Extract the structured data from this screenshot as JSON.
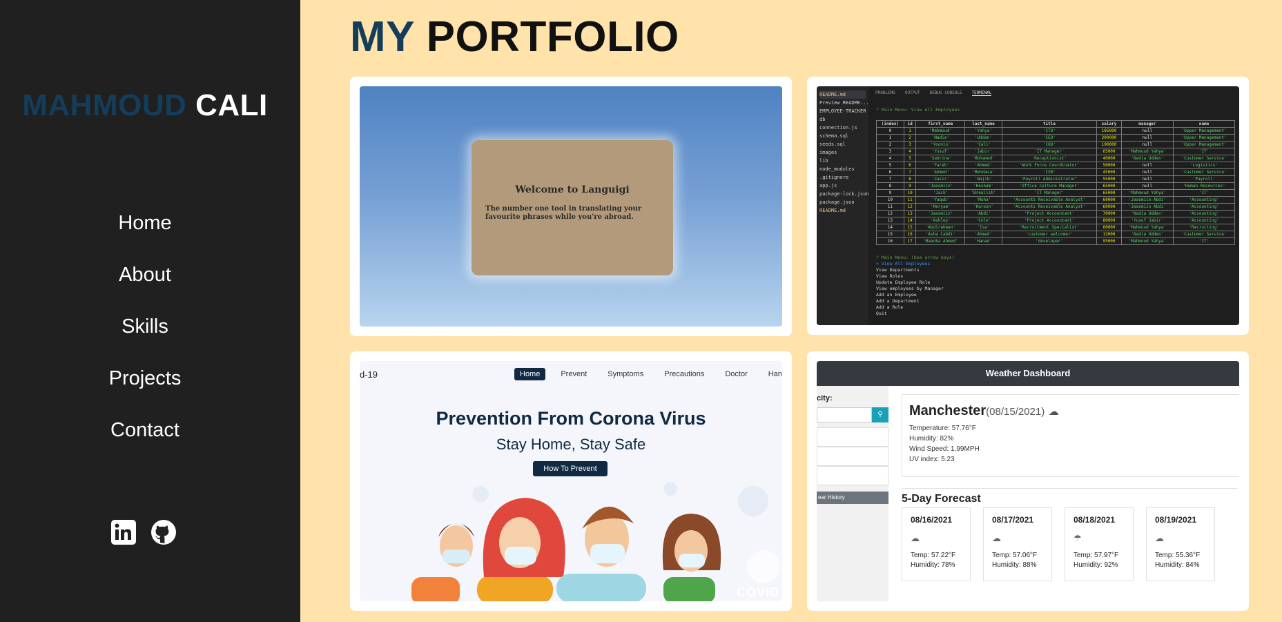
{
  "sidebar": {
    "brand_first": "MAHMOUD",
    "brand_last": "CALI",
    "nav": [
      "Home",
      "About",
      "Skills",
      "Projects",
      "Contact"
    ],
    "social": [
      "linkedin-icon",
      "github-icon"
    ]
  },
  "page": {
    "title_my": "MY",
    "title_rest": "PORTFOLIO"
  },
  "projects": {
    "languigi": {
      "heading": "Welcome to Languigi",
      "text": "The number one tool in translating your favourite phrases while you're abroad."
    },
    "employee_tracker": {
      "tabs": [
        "PROBLEMS",
        "OUTPUT",
        "DEBUG CONSOLE",
        "TERMINAL"
      ],
      "files": [
        "README.md",
        "Preview README...",
        "EMPLOYEE-TRACKER",
        "db",
        "connection.js",
        "schema.sql",
        "seeds.sql",
        "images",
        "lib",
        "node_modules",
        ".gitignore",
        "app.js",
        "package-lock.json",
        "package.json",
        "README.md"
      ],
      "menu_line": "? Main Menu: View All Employees",
      "columns": [
        "(index)",
        "id",
        "first_name",
        "last_name",
        "title",
        "salary",
        "manager",
        "name"
      ],
      "rows": [
        [
          "0",
          "1",
          "'Mahmoud'",
          "'Yahya'",
          "'CTO'",
          "185000",
          "null",
          "'Upper Management'"
        ],
        [
          "1",
          "2",
          "'Nadia'",
          "'Uddan'",
          "'CEO'",
          "200000",
          "null",
          "'Upper Management'"
        ],
        [
          "2",
          "3",
          "'Yoonis'",
          "'Cali'",
          "'COO'",
          "190000",
          "null",
          "'Upper Management'"
        ],
        [
          "3",
          "4",
          "'Yusuf'",
          "'Jabir'",
          "'IT Manager'",
          "65000",
          "'Mahmoud Yahya'",
          "'IT'"
        ],
        [
          "4",
          "5",
          "'Sabrina'",
          "'Mohamed'",
          "'Receptionist'",
          "40000",
          "'Nadia Udden'",
          "'Customer Service'"
        ],
        [
          "5",
          "6",
          "'Farah'",
          "'Ahmed'",
          "'Work Force Coordinator'",
          "50000",
          "null",
          "'Logistics'"
        ],
        [
          "6",
          "7",
          "'Ahmed'",
          "'Mendasa'",
          "'CSR'",
          "45000",
          "null",
          "'Customer Service'"
        ],
        [
          "7",
          "8",
          "'Jasir'",
          "'Najib'",
          "'Payroll Administrator'",
          "55000",
          "null",
          "'Payroll'"
        ],
        [
          "8",
          "9",
          "'Jaasmiin'",
          "'Hesham'",
          "'Office Culture Manager'",
          "65000",
          "null",
          "'Human Resources'"
        ],
        [
          "9",
          "10",
          "'Jack'",
          "'Brealish'",
          "'IT Manager'",
          "65000",
          "'Mahmoud Yahya'",
          "'IT'"
        ],
        [
          "10",
          "11",
          "'Yaqub'",
          "'Muha'",
          "'Accounts Receivable Analyst'",
          "60000",
          "'Jaasmiin Abdi'",
          "'Accounting'"
        ],
        [
          "11",
          "12",
          "'Maryam'",
          "'Haroon'",
          "'Accounts Receivable Analyst'",
          "60000",
          "'Jaasmiin Abdi'",
          "'Accounting'"
        ],
        [
          "12",
          "13",
          "'Jaasmiin'",
          "'Abdi'",
          "'Project Accountant'",
          "70000",
          "'Nadia Udden'",
          "'Accounting'"
        ],
        [
          "13",
          "14",
          "'Ashley'",
          "'Cole'",
          "'Project Accountant'",
          "80000",
          "'Yusuf Jabir'",
          "'Accounting'"
        ],
        [
          "14",
          "15",
          "'Abdirahman'",
          "'Isa'",
          "'Recruitment Specialist'",
          "60000",
          "'Mahmoud Yahya'",
          "'Recruiting'"
        ],
        [
          "15",
          "16",
          "'Asha Cabdi'",
          "'Ahmed'",
          "'customer welcomer'",
          "12000",
          "'Nadia Udden'",
          "'Customer Service'"
        ],
        [
          "16",
          "17",
          "'Maanka Ahmed'",
          "'Hanad'",
          "'developer'",
          "95000",
          "'Mahmoud Yahya'",
          "'IT'"
        ]
      ],
      "menu_prompt": "? Main Menu: (Use arrow keys)",
      "options": [
        "> View All Employees",
        "View Departments",
        "View Roles",
        "Update Employee Role",
        "View employees by Manager",
        "Add an Employee",
        "Add a Department",
        "Add a Role",
        "Quit"
      ]
    },
    "corona": {
      "logo": "d-19",
      "menu": [
        "Home",
        "Prevent",
        "Symptoms",
        "Precautions",
        "Doctor",
        "Hand-"
      ],
      "heading": "Prevention From Corona Virus",
      "subheading": "Stay Home, Stay Safe",
      "button": "How To Prevent",
      "corner_text": "COVID"
    },
    "weather": {
      "title": "Weather Dashboard",
      "search_label": "city:",
      "history_label": "ear History",
      "city": "Manchester",
      "date": "(08/15/2021)",
      "details": [
        "Temperature: 57.76°F",
        "Humidity: 82%",
        "Wind Speed: 1.99MPH",
        "UV index: 5.23"
      ],
      "forecast_title": "5-Day Forecast",
      "forecast": [
        {
          "date": "08/16/2021",
          "temp": "Temp: 57.22°F",
          "hum": "Humidity: 78%"
        },
        {
          "date": "08/17/2021",
          "temp": "Temp: 57.06°F",
          "hum": "Humidity: 88%"
        },
        {
          "date": "08/18/2021",
          "temp": "Temp: 57.97°F",
          "hum": "Humidity: 92%"
        },
        {
          "date": "08/19/2021",
          "temp": "Temp: 55.36°F",
          "hum": "Humidity: 84%"
        }
      ]
    }
  },
  "colors": {
    "background": "#ffe3aa",
    "sidebar": "#202020",
    "accent": "#143d5c"
  }
}
